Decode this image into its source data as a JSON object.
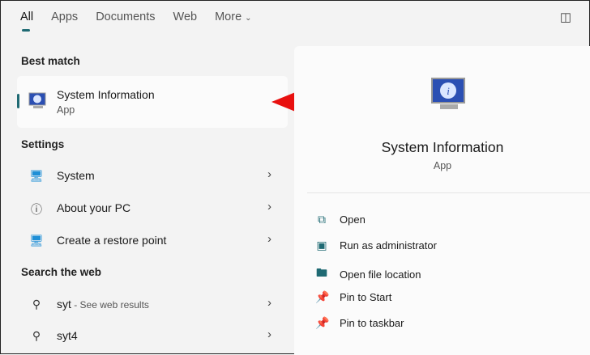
{
  "tabs": [
    "All",
    "Apps",
    "Documents",
    "Web",
    "More"
  ],
  "best_match": {
    "heading": "Best match",
    "title": "System Information",
    "type": "App"
  },
  "settings": {
    "heading": "Settings",
    "items": [
      "System",
      "About your PC",
      "Create a restore point"
    ]
  },
  "web": {
    "heading": "Search the web",
    "items": [
      {
        "query": "syt",
        "hint": " - See web results"
      },
      {
        "query": "syt4",
        "hint": ""
      }
    ]
  },
  "panel": {
    "title": "System Information",
    "type": "App",
    "actions": [
      "Open",
      "Run as administrator",
      "Open file location",
      "Pin to Start",
      "Pin to taskbar"
    ]
  },
  "colors": {
    "accent": "#1f6a73",
    "arrow": "#e8100f"
  }
}
